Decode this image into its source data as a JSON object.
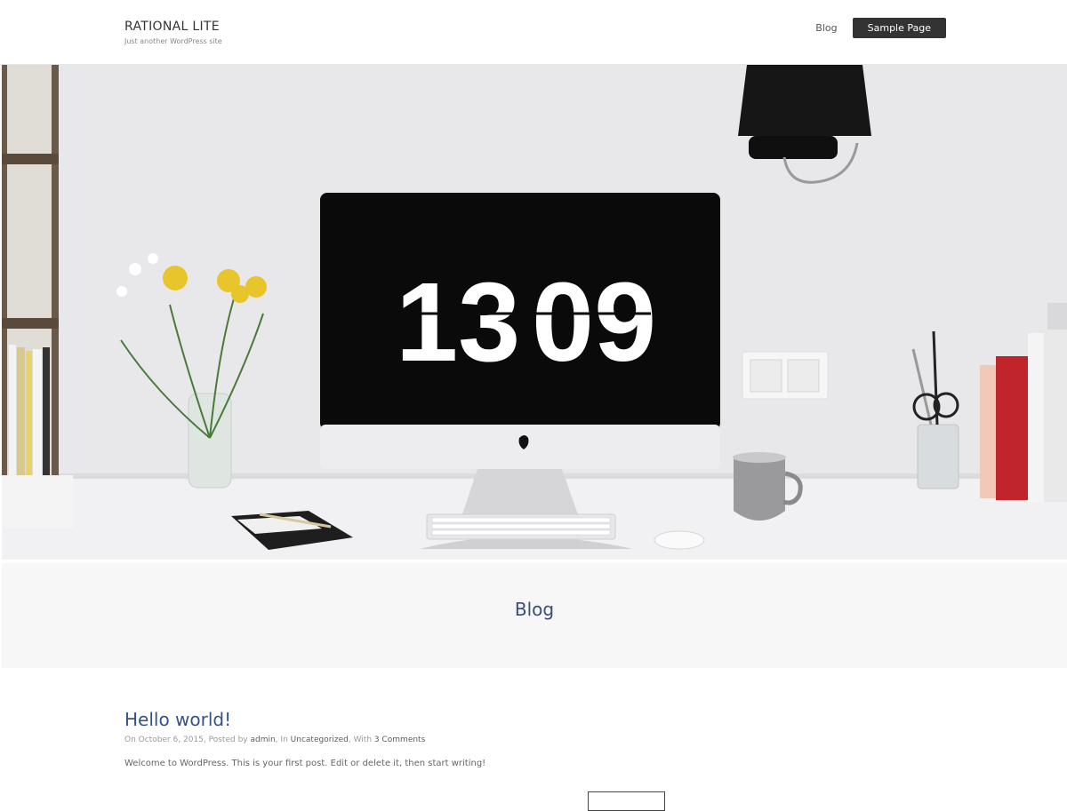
{
  "site": {
    "title": "RATIONAL LITE",
    "tagline": "Just another WordPress site"
  },
  "nav": {
    "items": [
      {
        "label": "Blog"
      },
      {
        "label": "Sample Page"
      }
    ]
  },
  "hero": {
    "clock_hours": "13",
    "clock_minutes": "09"
  },
  "banner": {
    "title": "Blog"
  },
  "post": {
    "title": "Hello world!",
    "meta": {
      "on": "On",
      "date": "October 6, 2015",
      "posted_by": ", Posted by",
      "author": "admin",
      "in": ", In",
      "category": "Uncategorized",
      "with": ", With",
      "comments": "3 Comments"
    },
    "excerpt": "Welcome to WordPress. This is your first post. Edit or delete it, then start writing!"
  },
  "colors": {
    "accent": "#34528a",
    "nav_button_bg": "#333333",
    "banner_bg": "#f7f7f7"
  }
}
